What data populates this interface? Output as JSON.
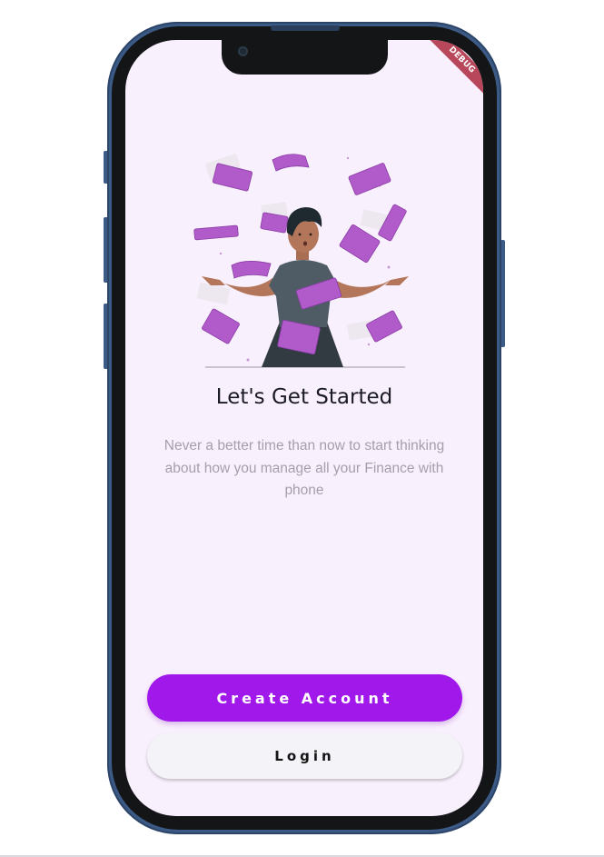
{
  "debug_banner": "DEBUG",
  "onboarding": {
    "title": "Let's Get Started",
    "subtitle": "Never a better time than now to start thinking about how you manage all your Finance with phone",
    "illustration": "person-with-flying-money-illustration"
  },
  "actions": {
    "create_account_label": "Create Account",
    "login_label": "Login"
  },
  "colors": {
    "screen_background": "#f9f0fd",
    "primary_button": "#a018ea",
    "secondary_button": "#f4f3f8",
    "money": "#b05bc9",
    "phone_frame": "#3c5a86"
  }
}
